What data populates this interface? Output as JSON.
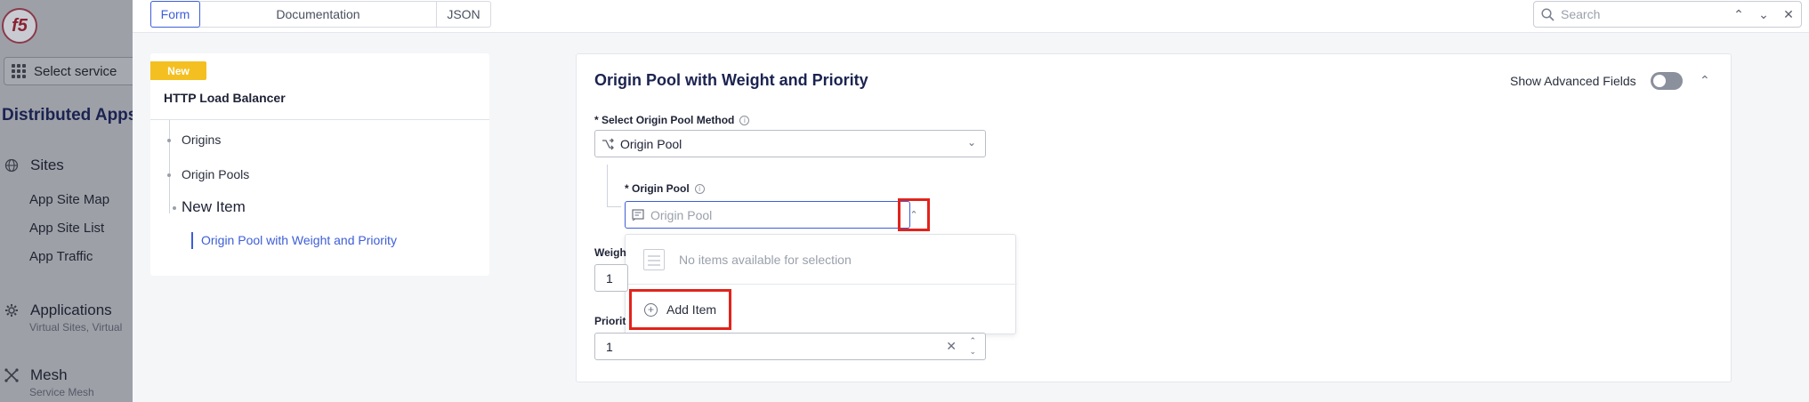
{
  "sidebar": {
    "logo_text": "f5",
    "select_service": "Select service",
    "workspace_title": "Distributed Apps",
    "sections": [
      {
        "label": "Sites",
        "icon": "globe-icon",
        "items": [
          "App Site Map",
          "App Site List",
          "App Traffic"
        ]
      },
      {
        "label": "Applications",
        "icon": "gear-icon",
        "subtitle": "Virtual Sites, Virtual"
      },
      {
        "label": "Mesh",
        "icon": "mesh-icon",
        "subtitle": "Service Mesh"
      }
    ]
  },
  "topbar": {
    "tabs": [
      "Form",
      "Documentation",
      "JSON"
    ],
    "active_tab": "Form",
    "search_placeholder": "Search"
  },
  "nav_card": {
    "badge": "New",
    "title": "HTTP Load Balancer",
    "items": [
      "Origins",
      "Origin Pools"
    ],
    "current_group": "New Item",
    "current_item": "Origin Pool with Weight and Priority"
  },
  "form": {
    "title": "Origin Pool with Weight and Priority",
    "show_advanced_label": "Show Advanced Fields",
    "show_advanced_on": false,
    "method_label": "* Select Origin Pool Method",
    "method_value": "Origin Pool",
    "origin_pool_label": "* Origin Pool",
    "origin_pool_placeholder": "Origin Pool",
    "dropdown_empty_text": "No items available for selection",
    "add_item_label": "Add Item",
    "weight_label": "Weigh",
    "weight_value": "1",
    "priority_label": "Priorit",
    "priority_value": "1"
  },
  "colors": {
    "accent": "#3d5ed8",
    "badge": "#f4c021",
    "highlight": "#e2231a",
    "navy": "#1b2350"
  }
}
